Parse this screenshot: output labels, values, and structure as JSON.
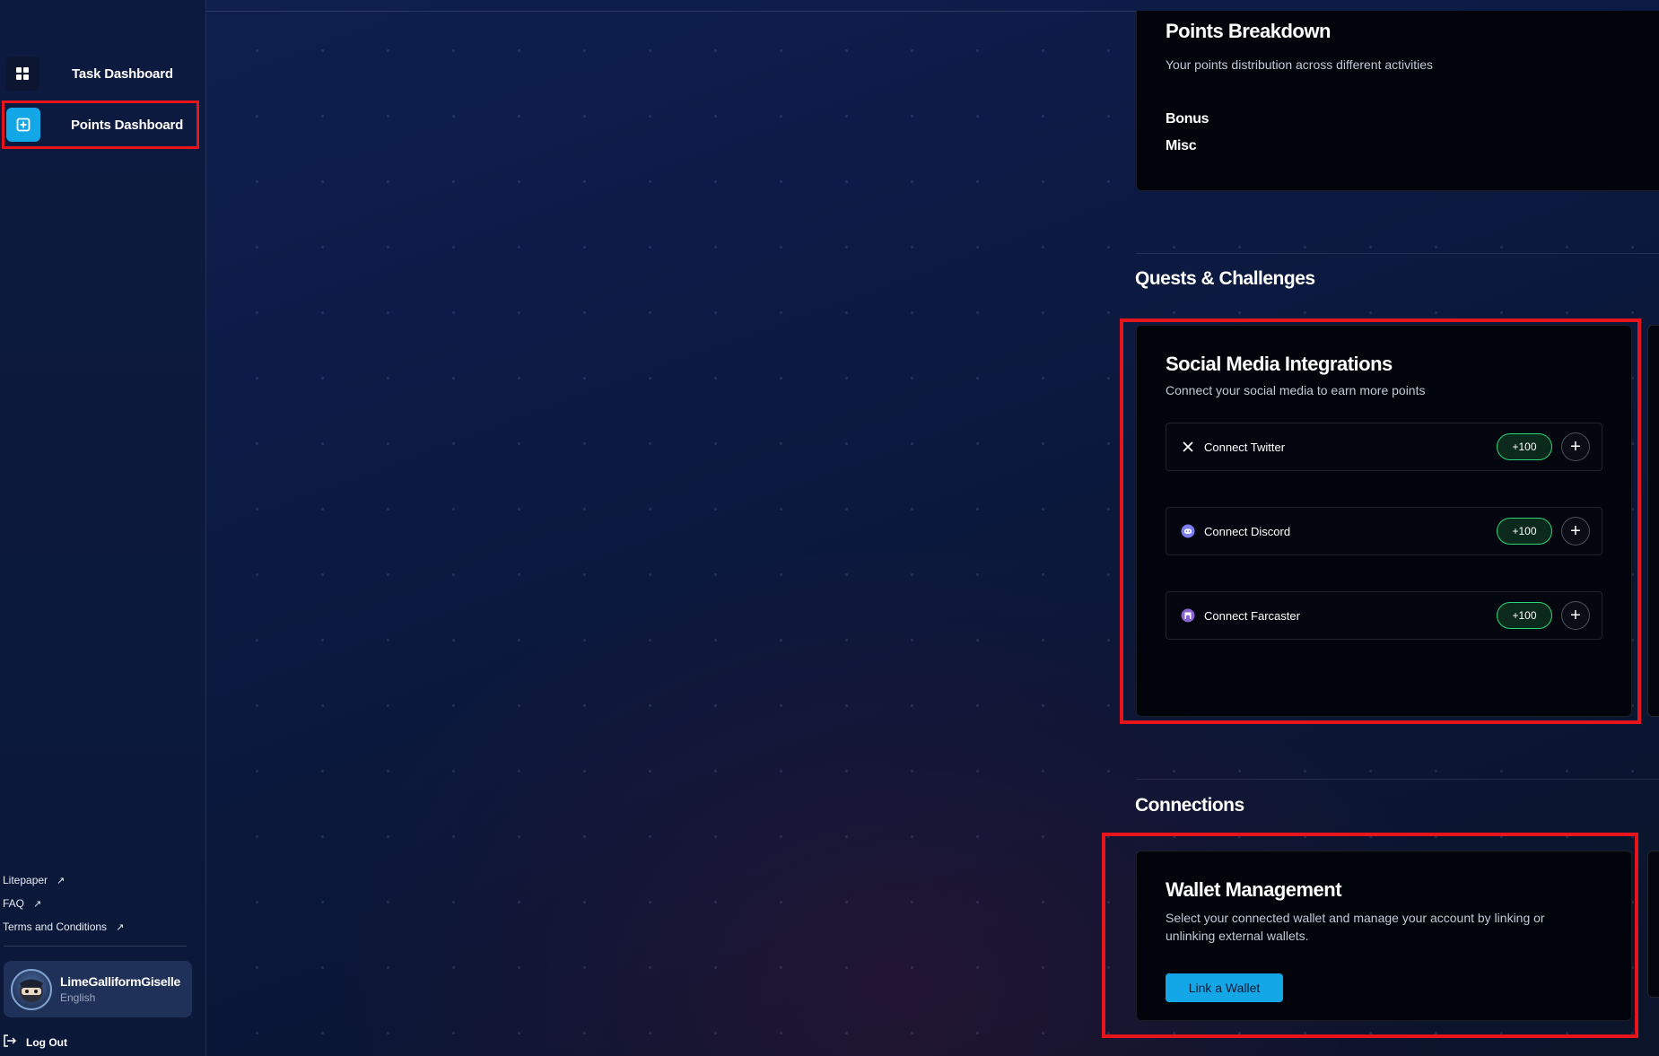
{
  "sidebar": {
    "nav": [
      {
        "label": "Task Dashboard",
        "icon": "grid-icon"
      },
      {
        "label": "Points Dashboard",
        "icon": "plus-square-icon"
      }
    ],
    "links": [
      {
        "label": "Litepaper",
        "icon": "external-arrow-icon"
      },
      {
        "label": "FAQ",
        "icon": "external-arrow-icon"
      },
      {
        "label": "Terms and Conditions",
        "icon": "external-arrow-icon"
      }
    ],
    "user": {
      "name": "LimeGalliformGiselle",
      "language": "English"
    },
    "logout_label": "Log Out"
  },
  "points_breakdown": {
    "title": "Points Breakdown",
    "subtitle": "Your points distribution across different activities",
    "items": [
      "Bonus",
      "Misc"
    ]
  },
  "quests": {
    "section_title": "Quests & Challenges",
    "card_title": "Social Media Integrations",
    "card_subtitle": "Connect your social media to earn more points",
    "rows": [
      {
        "label": "Connect Twitter",
        "points": "+100",
        "icon": "x-twitter-icon"
      },
      {
        "label": "Connect Discord",
        "points": "+100",
        "icon": "discord-icon"
      },
      {
        "label": "Connect Farcaster",
        "points": "+100",
        "icon": "farcaster-icon"
      }
    ]
  },
  "connections": {
    "section_title": "Connections",
    "card_title": "Wallet Management",
    "card_subtitle": "Select your connected wallet and manage your account by linking or unlinking external wallets.",
    "button_label": "Link a Wallet"
  },
  "colors": {
    "accent": "#14a7e8",
    "highlight": "#e8141c",
    "badge_border": "#2bd67b",
    "background": "#0b1530",
    "card": "#02040b"
  }
}
